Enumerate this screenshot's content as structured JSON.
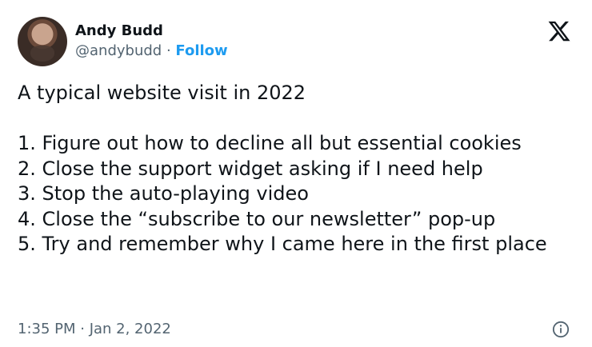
{
  "author": {
    "display_name": "Andy Budd",
    "handle": "@andybudd",
    "separator": "·",
    "follow_label": "Follow"
  },
  "tweet": {
    "text": "A typical website visit in 2022\n\n1. Figure out how to decline all but essential cookies\n2. Close the support widget asking if I need help\n3. Stop the auto-playing video\n4. Close the “subscribe to our newsletter” pop-up\n5. Try and remember why I came here in the first place",
    "timestamp": "1:35 PM · Jan 2, 2022"
  },
  "icons": {
    "brand": "x-logo-icon",
    "info": "info-icon"
  },
  "colors": {
    "accent": "#1d9bf0",
    "text": "#0f1419",
    "muted": "#536471"
  }
}
